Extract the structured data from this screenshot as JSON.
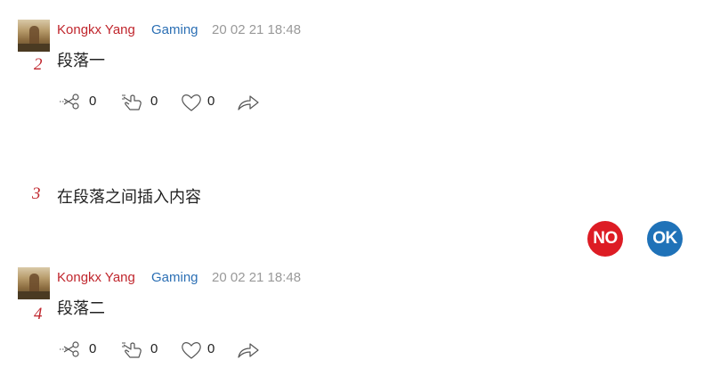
{
  "posts": [
    {
      "number": "2",
      "author": "Kongkx Yang",
      "tag": "Gaming",
      "time": "20 02 21 18:48",
      "content": "段落一",
      "actions": {
        "cut": "0",
        "drag": "0",
        "like": "0"
      }
    },
    {
      "number": "4",
      "author": "Kongkx Yang",
      "tag": "Gaming",
      "time": "20 02 21 18:48",
      "content": "段落二",
      "actions": {
        "cut": "0",
        "drag": "0",
        "like": "0"
      }
    }
  ],
  "insert": {
    "number": "3",
    "content": "在段落之间插入内容",
    "no_label": "NO",
    "ok_label": "OK"
  },
  "colors": {
    "accent_red": "#c0262d",
    "link_blue": "#2b6fb4",
    "no_button": "#dd1c24",
    "ok_button": "#1f72b8"
  },
  "icons": [
    "avatar",
    "scissors-icon",
    "drag-hand-icon",
    "heart-icon",
    "share-icon"
  ]
}
